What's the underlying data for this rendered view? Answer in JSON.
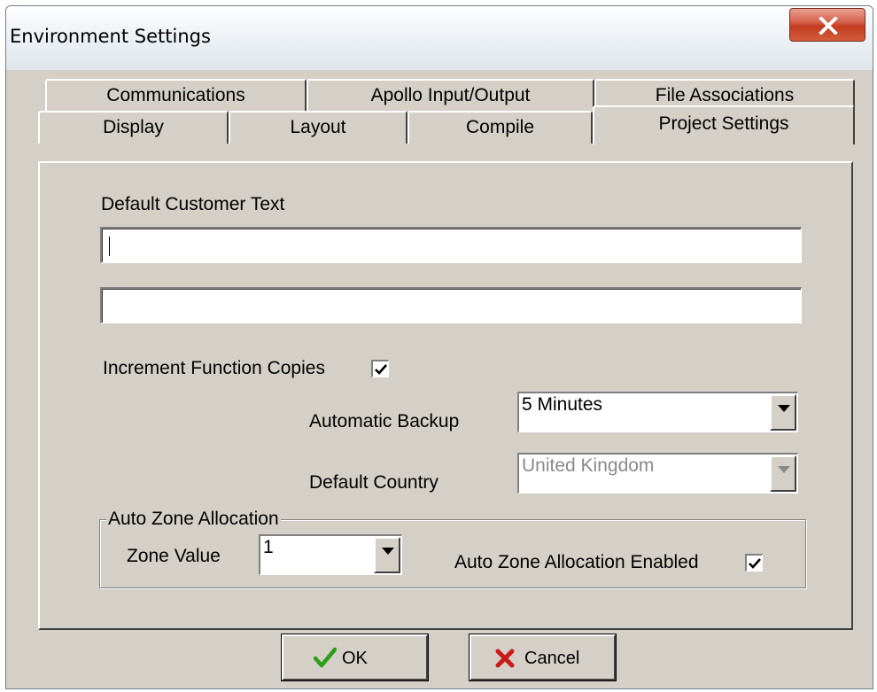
{
  "window": {
    "title": "Environment Settings"
  },
  "tabs": {
    "row1": [
      "Communications",
      "Apollo Input/Output",
      "File Associations"
    ],
    "row2": [
      "Display",
      "Layout",
      "Compile",
      "Project Settings"
    ],
    "active": "Project Settings"
  },
  "project_settings": {
    "default_customer_text_label": "Default Customer Text",
    "customer_text_line1": "",
    "customer_text_line2": "",
    "increment_function_copies_label": "Increment Function Copies",
    "increment_function_copies_checked": true,
    "automatic_backup_label": "Automatic Backup",
    "automatic_backup_value": "5 Minutes",
    "default_country_label": "Default Country",
    "default_country_value": "United Kingdom",
    "default_country_enabled": false,
    "auto_zone_group_title": "Auto Zone Allocation",
    "zone_value_label": "Zone Value",
    "zone_value": "1",
    "auto_zone_enabled_label": "Auto Zone Allocation Enabled",
    "auto_zone_enabled_checked": true
  },
  "buttons": {
    "ok": "OK",
    "cancel": "Cancel"
  },
  "icons": {
    "close": "close-icon",
    "ok": "checkmark-icon",
    "cancel": "red-x-icon",
    "dropdown": "chevron-down-icon"
  },
  "colors": {
    "close_button": "#c23a1f",
    "ok_check": "#2e9e1a",
    "cancel_x": "#cc1a1a"
  }
}
